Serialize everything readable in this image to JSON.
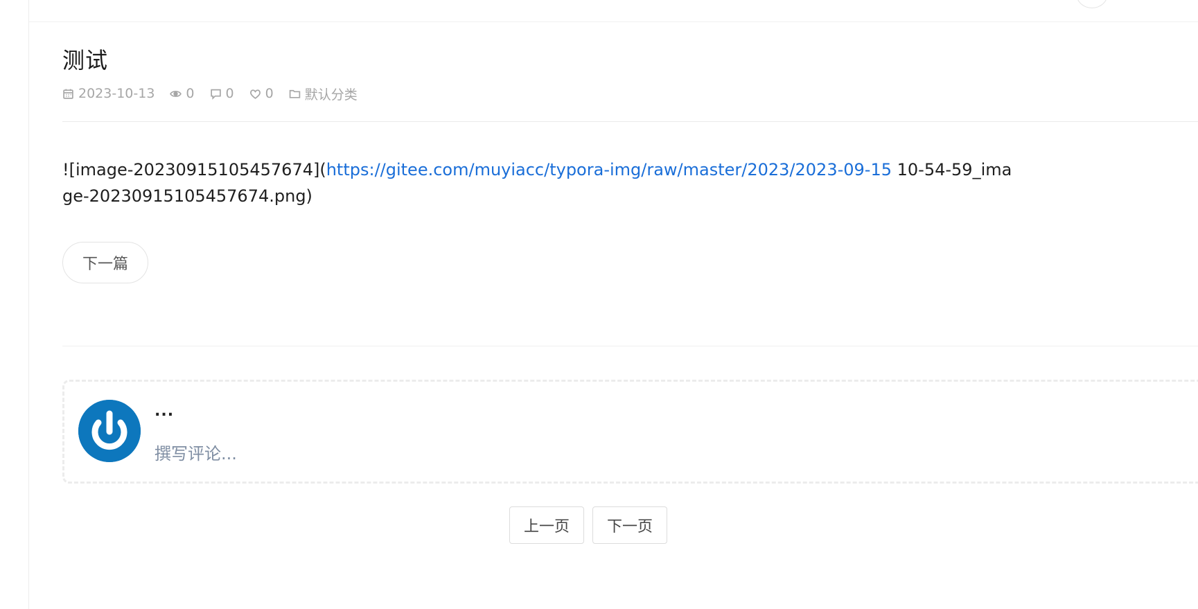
{
  "post": {
    "title": "测试",
    "meta": {
      "date": "2023-10-13",
      "views": "0",
      "comments": "0",
      "likes": "0",
      "category": "默认分类"
    },
    "body": {
      "prefix": "![image-20230915105457674](",
      "link_text": "https://gitee.com/muyiacc/typora-img/raw/master/2023/2023-09-15",
      "suffix": " 10-54-59_image-20230915105457674.png)"
    },
    "next_post_label": "下一篇"
  },
  "comment_form": {
    "username": "...",
    "placeholder": "撰写评论..."
  },
  "pagination": {
    "prev_label": "上一页",
    "next_label": "下一页"
  },
  "icons": {
    "date": "calendar-icon",
    "views": "eye-icon",
    "comments": "comment-icon",
    "likes": "heart-icon",
    "category": "folder-icon",
    "avatar": "power-icon"
  },
  "colors": {
    "link": "#1a6ed8",
    "meta": "#a6a6a6",
    "avatar_bg": "#0d77bd",
    "placeholder": "#7f8ea3"
  }
}
